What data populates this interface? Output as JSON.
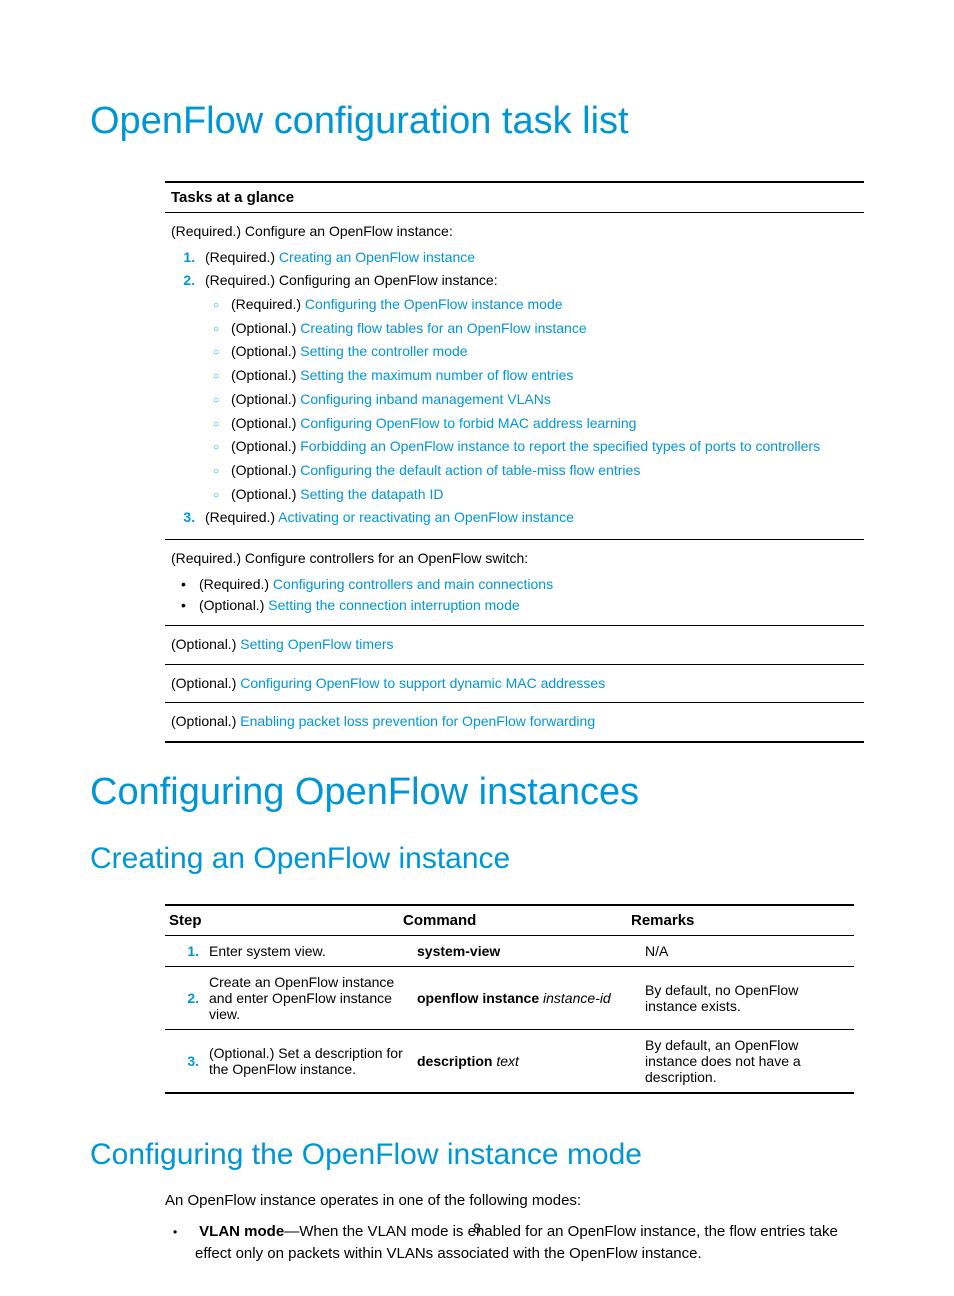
{
  "h1a": "OpenFlow configuration task list",
  "tasks_header": "Tasks at a glance",
  "t1_intro": "(Required.) Configure an OpenFlow instance:",
  "t1_li1_pref": "(Required.) ",
  "t1_li1_link": "Creating an OpenFlow instance",
  "t1_li2": "(Required.) Configuring an OpenFlow instance:",
  "sub": {
    "a_pref": "(Required.) ",
    "a_link": "Configuring the OpenFlow instance mode",
    "b_pref": "(Optional.) ",
    "b_link": "Creating flow tables for an OpenFlow instance",
    "c_pref": "(Optional.) ",
    "c_link": "Setting the controller mode",
    "d_pref": "(Optional.) ",
    "d_link": "Setting the maximum number of flow entries",
    "e_pref": "(Optional.) ",
    "e_link": "Configuring inband management VLANs",
    "f_pref": "(Optional.) ",
    "f_link": "Configuring OpenFlow to forbid MAC address learning",
    "g_pref": "(Optional.) ",
    "g_link": "Forbidding an OpenFlow instance to report the specified types of ports to controllers",
    "h_pref": "(Optional.) ",
    "h_link": "Configuring the default action of table-miss flow entries",
    "i_pref": "(Optional.) ",
    "i_link": "Setting the datapath ID"
  },
  "t1_li3_pref": "(Required.) ",
  "t1_li3_link": "Activating or reactivating an OpenFlow instance",
  "t2_intro": "(Required.) Configure controllers for an OpenFlow switch:",
  "t2_a_pref": "(Required.) ",
  "t2_a_link": "Configuring controllers and main connections",
  "t2_b_pref": "(Optional.) ",
  "t2_b_link": "Setting the connection interruption mode",
  "t3_pref": "(Optional.) ",
  "t3_link": "Setting OpenFlow timers",
  "t4_pref": "(Optional.) ",
  "t4_link": "Configuring OpenFlow to support dynamic MAC addresses",
  "t5_pref": "(Optional.) ",
  "t5_link": "Enabling packet loss prevention for OpenFlow forwarding",
  "h1b": "Configuring OpenFlow instances",
  "h2a": "Creating an OpenFlow instance",
  "steps": {
    "h_step": "Step",
    "h_cmd": "Command",
    "h_rem": "Remarks",
    "r1": {
      "n": "1.",
      "step": "Enter system view.",
      "cmd_b": "system-view",
      "cmd_i": "",
      "rem": "N/A"
    },
    "r2": {
      "n": "2.",
      "step": "Create an OpenFlow instance and enter OpenFlow instance view.",
      "cmd_b": "openflow instance ",
      "cmd_i": "instance-id",
      "rem": "By default, no OpenFlow instance exists."
    },
    "r3": {
      "n": "3.",
      "step": "(Optional.) Set a description for the OpenFlow instance.",
      "cmd_b": "description ",
      "cmd_i": "text",
      "rem": "By default, an OpenFlow instance does not have a description."
    }
  },
  "h2b": "Configuring the OpenFlow instance mode",
  "body1": "An OpenFlow instance operates in one of the following modes:",
  "vlan_b": "VLAN mode",
  "vlan_rest": "—When the VLAN mode is enabled for an OpenFlow instance, the flow entries take effect only on packets within VLANs associated with the OpenFlow instance.",
  "page_no": "8"
}
